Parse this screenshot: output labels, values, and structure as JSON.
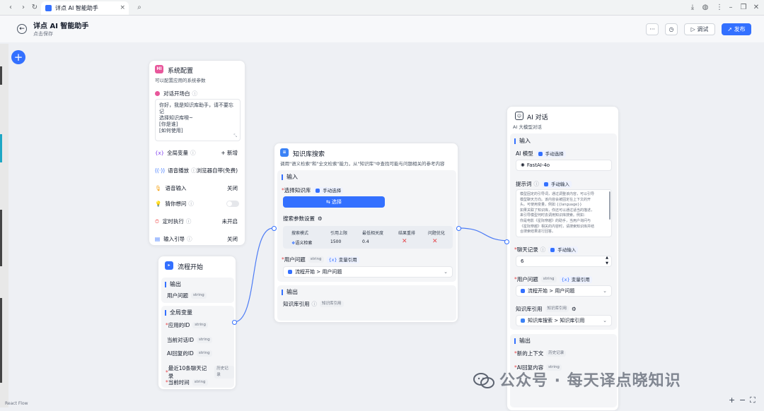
{
  "browser": {
    "tab_title": "详点 AI 智能助手",
    "close": "×"
  },
  "header": {
    "title": "详点 AI 智能助手",
    "subtitle": "点击保存",
    "more": "···",
    "debug": "调试",
    "publish": "发布"
  },
  "system_node": {
    "icon_text": "HI",
    "title": "系统配置",
    "desc": "可以配置应用的系统参数",
    "opening_label": "对话开场白",
    "opening_text": [
      "你好，我是知识库助手，请不要忘记",
      "选择知识库噢~",
      "[你是谁]",
      "[如何使用]"
    ],
    "rows": [
      {
        "label": "全局变量",
        "value": "+ 新增"
      },
      {
        "label": "语音播放",
        "value": "浏览器自带(免费)"
      },
      {
        "label": "语音输入",
        "value": "关闭"
      },
      {
        "label": "猜你想问",
        "value": ""
      },
      {
        "label": "定时执行",
        "value": "未开启"
      },
      {
        "label": "输入引导",
        "value": "关闭"
      }
    ]
  },
  "start_node": {
    "title": "流程开始",
    "output_label": "输出",
    "output_item": "用户问题",
    "string_chip": "string",
    "global_label": "全局变量",
    "globals": [
      {
        "label": "应用的ID",
        "chip": "string",
        "required": true
      },
      {
        "label": "当前对话ID",
        "chip": "string",
        "required": false
      },
      {
        "label": "AI回复的ID",
        "chip": "string",
        "required": false
      },
      {
        "label": "最近10条聊天记录",
        "chip": "历史记录",
        "required": true
      },
      {
        "label": "当前时间",
        "chip": "string",
        "required": true
      }
    ]
  },
  "kb_node": {
    "title": "知识库搜索",
    "desc": "调用\"语义检索\"和\"全文检索\"能力，从\"知识库\"中查找可能与问题相关的参考内容",
    "input_label": "输入",
    "select_kb_label": "选择知识库",
    "manual_select": "手动选择",
    "select_btn": "选择",
    "params_label": "搜索参数设置",
    "table_headers": [
      "搜索模式",
      "引用上限",
      "最低相关度",
      "结果重排",
      "问题优化"
    ],
    "table_values": [
      "语义检索",
      "1500",
      "0.4",
      "✕",
      "✕"
    ],
    "question_label": "用户问题",
    "string_chip": "string",
    "var_ref": "变量引用",
    "question_path": "流程开始 > 用户问题",
    "output_label": "输出",
    "output_item": "知识库引用",
    "output_chip": "知识库引用"
  },
  "ai_node": {
    "title": "AI 对话",
    "desc": "AI 大模型对话",
    "input_label": "输入",
    "model_label": "AI 模型",
    "manual_select": "手动选择",
    "model_value": "FastAI-4o",
    "prompt_label": "提示词",
    "manual_input": "手动输入",
    "prompt_text": [
      "模型固定的引导词，通过调整该内容，可以引导",
      "模型聊天方向。该内容会被固定在上下文的开",
      "头。可使用变量，例如 {{language}}",
      "如果关联了知识库，你还可以通过适当的描述，",
      "来引导模型何时去调用知识库搜索。例如：",
      "你是电影《星际穿越》的助手，当用户询问与",
      "《星际穿越》相关的内容时，请搜索知识库并结",
      "合搜索结果进行回答。"
    ],
    "history_label": "聊天记录",
    "history_value": "6",
    "question_label": "用户问题",
    "string_chip": "string",
    "var_ref": "变量引用",
    "question_path": "流程开始 > 用户问题",
    "kb_label": "知识库引用",
    "kb_chip": "知识库引用",
    "kb_path": "知识库搜索 > 知识库引用",
    "output_label": "输出",
    "out_items": [
      {
        "label": "新的上下文",
        "chip": "历史记录"
      },
      {
        "label": "AI回复内容",
        "chip": "string"
      }
    ]
  },
  "watermark": "公众号 · 每天译点晓知识",
  "footer": "React Flow",
  "colors": {
    "accent": "#3370ff",
    "danger": "#e5484d",
    "pink": "#e8579b"
  }
}
